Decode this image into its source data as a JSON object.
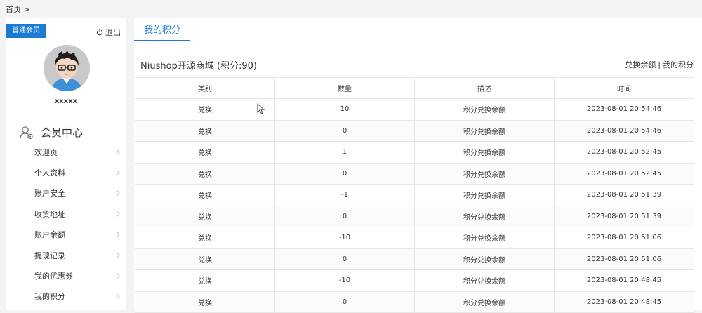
{
  "breadcrumb": {
    "home": "首页 >"
  },
  "sidebar": {
    "member_level": "普通会员",
    "logout_label": "退出",
    "username": "xxxxx",
    "section_title": "会员中心",
    "items": [
      {
        "label": "欢迎页"
      },
      {
        "label": "个人资料"
      },
      {
        "label": "账户安全"
      },
      {
        "label": "收货地址"
      },
      {
        "label": "账户余额"
      },
      {
        "label": "提现记录"
      },
      {
        "label": "我的优惠券"
      },
      {
        "label": "我的积分"
      }
    ]
  },
  "main": {
    "tab_label": "我的积分",
    "store_title": "Niushop开源商城 (积分:90)",
    "links": {
      "exchange_balance": "兑换余额",
      "separator": "|",
      "my_points": "我的积分"
    },
    "table": {
      "headers": [
        "类别",
        "数量",
        "描述",
        "时间"
      ],
      "rows": [
        [
          "兑换",
          "10",
          "积分兑换余额",
          "2023-08-01 20:54:46"
        ],
        [
          "兑换",
          "0",
          "积分兑换余额",
          "2023-08-01 20:54:46"
        ],
        [
          "兑换",
          "1",
          "积分兑换余额",
          "2023-08-01 20:52:45"
        ],
        [
          "兑换",
          "0",
          "积分兑换余额",
          "2023-08-01 20:52:45"
        ],
        [
          "兑换",
          "-1",
          "积分兑换余额",
          "2023-08-01 20:51:39"
        ],
        [
          "兑换",
          "0",
          "积分兑换余额",
          "2023-08-01 20:51:39"
        ],
        [
          "兑换",
          "-10",
          "积分兑换余额",
          "2023-08-01 20:51:06"
        ],
        [
          "兑换",
          "0",
          "积分兑换余额",
          "2023-08-01 20:51:06"
        ],
        [
          "兑换",
          "-10",
          "积分兑换余额",
          "2023-08-01 20:48:45"
        ],
        [
          "兑换",
          "0",
          "积分兑换余额",
          "2023-08-01 20:48:45"
        ]
      ]
    }
  },
  "colors": {
    "accent": "#1a7ad4",
    "border": "#e6e6e6",
    "background": "#f3f3f3"
  }
}
